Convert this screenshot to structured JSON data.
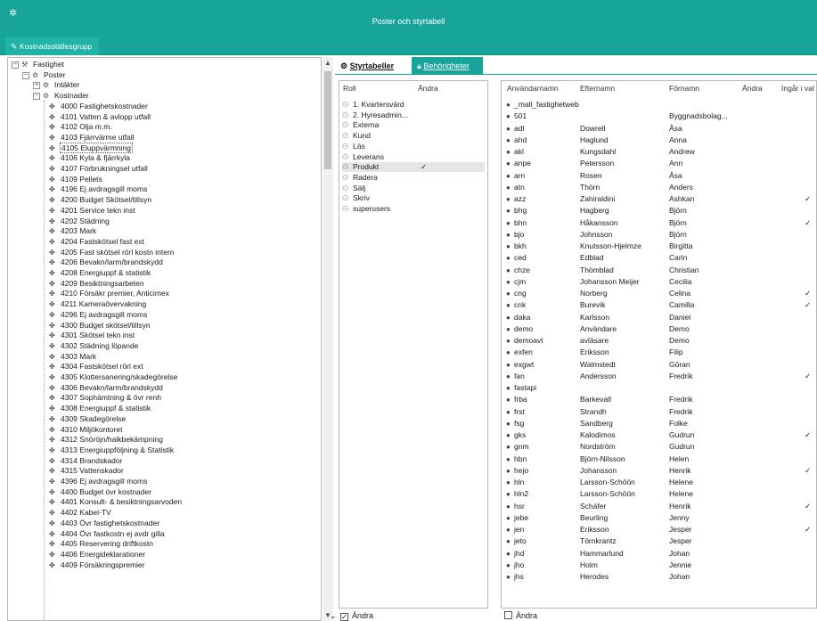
{
  "window": {
    "title": "Poster och styrtabell",
    "icon": "gear-icon"
  },
  "group_tab": {
    "label": "Kostnadsställesgrupp",
    "icon": "pencil-icon"
  },
  "tree": {
    "nodes": [
      {
        "label": "Fastighet",
        "level": 0,
        "exp": "−",
        "icon": "fastighet"
      },
      {
        "label": "Poster",
        "level": 1,
        "exp": "−",
        "icon": "poster"
      },
      {
        "label": "Intäkter",
        "level": 2,
        "exp": "+",
        "icon": "group"
      },
      {
        "label": "Kostnader",
        "level": 2,
        "exp": "−",
        "icon": "group"
      },
      {
        "label": "4000 Fastighetskostnader",
        "level": 3
      },
      {
        "label": "4101 Vatten & avlopp utfall",
        "level": 3
      },
      {
        "label": "4102 Olja m.m.",
        "level": 3
      },
      {
        "label": "4103 Fjärrvärme utfall",
        "level": 3
      },
      {
        "label": "4105 Eluppvärmning",
        "level": 3,
        "selected": true
      },
      {
        "label": "4106 Kyla & fjärrkyla",
        "level": 3
      },
      {
        "label": "4107 Förbrukningsel utfall",
        "level": 3
      },
      {
        "label": "4109 Pellets",
        "level": 3
      },
      {
        "label": "4196 Ej avdragsgill moms",
        "level": 3
      },
      {
        "label": "4200 Budget Skötsel/tillsyn",
        "level": 3
      },
      {
        "label": "4201 Service tekn inst",
        "level": 3
      },
      {
        "label": "4202 Städning",
        "level": 3
      },
      {
        "label": "4203 Mark",
        "level": 3
      },
      {
        "label": "4204 Fastskötsel fast ext",
        "level": 3
      },
      {
        "label": "4205 Fast skötsel rörl kostn intern",
        "level": 3
      },
      {
        "label": "4206 Bevakn/larm/brandskydd",
        "level": 3
      },
      {
        "label": "4208 Energiuppf & statistik",
        "level": 3
      },
      {
        "label": "4209 Besiktningsarbeten",
        "level": 3
      },
      {
        "label": "4210 Försäkr premier, Anticimex",
        "level": 3
      },
      {
        "label": "4211 Kameraövervakning",
        "level": 3
      },
      {
        "label": "4296 Ej avdragsgill moms",
        "level": 3
      },
      {
        "label": "4300 Budget skötsel/tillsyn",
        "level": 3
      },
      {
        "label": "4301 Skötsel tekn inst",
        "level": 3
      },
      {
        "label": "4302 Städning löpande",
        "level": 3
      },
      {
        "label": "4303 Mark",
        "level": 3
      },
      {
        "label": "4304 Fastskötsel rörl ext",
        "level": 3
      },
      {
        "label": "4305 Klottersanering/skadegörelse",
        "level": 3
      },
      {
        "label": "4306 Bevakn/larm/brandskydd",
        "level": 3
      },
      {
        "label": "4307 Sophämtning & övr renh",
        "level": 3
      },
      {
        "label": "4308 Energiuppf & statistik",
        "level": 3
      },
      {
        "label": "4309 Skadegörelse",
        "level": 3
      },
      {
        "label": "4310 Miljökontoret",
        "level": 3
      },
      {
        "label": "4312 Snöröjn/halkbekämpning",
        "level": 3
      },
      {
        "label": "4313 Energiuppföljning & Statistik",
        "level": 3
      },
      {
        "label": "4314 Brandskador",
        "level": 3
      },
      {
        "label": "4315 Vattenskador",
        "level": 3
      },
      {
        "label": "4396 Ej avdragsgill moms",
        "level": 3
      },
      {
        "label": "4400 Budget övr kostnader",
        "level": 3
      },
      {
        "label": "4401 Konsult- & besiktningsarvoden",
        "level": 3
      },
      {
        "label": "4402 Kabel-TV",
        "level": 3
      },
      {
        "label": "4403 Övr fastighetskostnader",
        "level": 3
      },
      {
        "label": "4404 Övr fastkostn ej avdr gilla",
        "level": 3
      },
      {
        "label": "4405 Reservering driftkostn",
        "level": 3
      },
      {
        "label": "4406 Energideklarationer",
        "level": 3
      },
      {
        "label": "4409 Försäkringspremier",
        "level": 3
      }
    ]
  },
  "tabs": [
    {
      "label": "Styrtabeller",
      "icon": "tree-icon",
      "active": false
    },
    {
      "label": "Behörigheter",
      "icon": "lock-icon",
      "active": true
    }
  ],
  "roles": {
    "headers": {
      "roll": "Roll",
      "andra": "Ändra"
    },
    "rows": [
      {
        "name": "1. Kvartersvärd",
        "andra": ""
      },
      {
        "name": "2. Hyresadmin...",
        "andra": ""
      },
      {
        "name": "Externa",
        "andra": ""
      },
      {
        "name": "Kund",
        "andra": ""
      },
      {
        "name": "Läs",
        "andra": ""
      },
      {
        "name": "Leverans",
        "andra": ""
      },
      {
        "name": "Produkt",
        "andra": "✓",
        "selected": true
      },
      {
        "name": "Radera",
        "andra": ""
      },
      {
        "name": "Sälj",
        "andra": ""
      },
      {
        "name": "Skriv",
        "andra": ""
      },
      {
        "name": "superusers",
        "andra": ""
      }
    ],
    "footer": {
      "checked": true,
      "label": "Ändra"
    }
  },
  "users": {
    "headers": {
      "user": "Användarnamn",
      "last": "Efternamn",
      "first": "Förnamn",
      "andra": "Ändra",
      "ingar": "Ingår i val"
    },
    "rows": [
      {
        "u": "_mall_fastighetweb",
        "l": "",
        "f": "",
        "c": ""
      },
      {
        "u": "501",
        "l": "",
        "f": "Byggnadsbolag...",
        "c": ""
      },
      {
        "u": "adl",
        "l": "Dowrell",
        "f": "Åsa",
        "c": ""
      },
      {
        "u": "ahd",
        "l": "Haglund",
        "f": "Anna",
        "c": ""
      },
      {
        "u": "akl",
        "l": "Kungsdahl",
        "f": "Andrew",
        "c": ""
      },
      {
        "u": "anpe",
        "l": "Petersson",
        "f": "Ann",
        "c": ""
      },
      {
        "u": "arn",
        "l": "Rosen",
        "f": "Åsa",
        "c": ""
      },
      {
        "u": "atn",
        "l": "Thörn",
        "f": "Anders",
        "c": ""
      },
      {
        "u": "azz",
        "l": "Zahiraldini",
        "f": "Ashkan",
        "c": "✓"
      },
      {
        "u": "bhg",
        "l": "Hagberg",
        "f": "Björn",
        "c": ""
      },
      {
        "u": "bhn",
        "l": "Håkansson",
        "f": "Björn",
        "c": "✓"
      },
      {
        "u": "bjo",
        "l": "Johnsson",
        "f": "Björn",
        "c": ""
      },
      {
        "u": "bkh",
        "l": "Knutsson-Hjelmze",
        "f": "Birgitta",
        "c": ""
      },
      {
        "u": "ced",
        "l": "Edblad",
        "f": "Carin",
        "c": ""
      },
      {
        "u": "chze",
        "l": "Thömblad",
        "f": "Christian",
        "c": ""
      },
      {
        "u": "cjm",
        "l": "Johansson Meijer",
        "f": "Cecilia",
        "c": ""
      },
      {
        "u": "cng",
        "l": "Norberg",
        "f": "Celina",
        "c": "✓"
      },
      {
        "u": "cnk",
        "l": "Burevik",
        "f": "Camilla",
        "c": "✓"
      },
      {
        "u": "daka",
        "l": "Karlsson",
        "f": "Daniel",
        "c": ""
      },
      {
        "u": "demo",
        "l": "Användare",
        "f": "Demo",
        "c": ""
      },
      {
        "u": "demoavl",
        "l": "avläsare",
        "f": "Demo",
        "c": ""
      },
      {
        "u": "exfen",
        "l": "Eriksson",
        "f": "Filip",
        "c": ""
      },
      {
        "u": "exgwt",
        "l": "Walmstedt",
        "f": "Göran",
        "c": ""
      },
      {
        "u": "fan",
        "l": "Andersson",
        "f": "Fredrik",
        "c": "✓"
      },
      {
        "u": "fastapi",
        "l": "",
        "f": "",
        "c": ""
      },
      {
        "u": "frba",
        "l": "Barkevall",
        "f": "Fredrik",
        "c": ""
      },
      {
        "u": "frst",
        "l": "Strandh",
        "f": "Fredrik",
        "c": ""
      },
      {
        "u": "fsg",
        "l": "Sandberg",
        "f": "Folke",
        "c": ""
      },
      {
        "u": "gks",
        "l": "Kalodimos",
        "f": "Gudrun",
        "c": "✓"
      },
      {
        "u": "gnm",
        "l": "Nordström",
        "f": "Gudrun",
        "c": ""
      },
      {
        "u": "hbn",
        "l": "Björn-Nilsson",
        "f": "Helen",
        "c": ""
      },
      {
        "u": "hejo",
        "l": "Johansson",
        "f": "Henrik",
        "c": "✓"
      },
      {
        "u": "hln",
        "l": "Larsson-Schöön",
        "f": "Helene",
        "c": ""
      },
      {
        "u": "hln2",
        "l": "Larsson-Schöön",
        "f": "Helene",
        "c": ""
      },
      {
        "u": "hsr",
        "l": "Schäfer",
        "f": "Henrik",
        "c": "✓"
      },
      {
        "u": "jebe",
        "l": "Beurling",
        "f": "Jenny",
        "c": ""
      },
      {
        "u": "jen",
        "l": "Eriksson",
        "f": "Jesper",
        "c": "✓"
      },
      {
        "u": "jeto",
        "l": "Törnkrantz",
        "f": "Jesper",
        "c": ""
      },
      {
        "u": "jhd",
        "l": "Hammarlund",
        "f": "Johan",
        "c": ""
      },
      {
        "u": "jho",
        "l": "Holm",
        "f": "Jennie",
        "c": ""
      },
      {
        "u": "jhs",
        "l": "Herodes",
        "f": "Johan",
        "c": ""
      }
    ],
    "footer": {
      "checked": false,
      "label": "Ändra"
    }
  }
}
